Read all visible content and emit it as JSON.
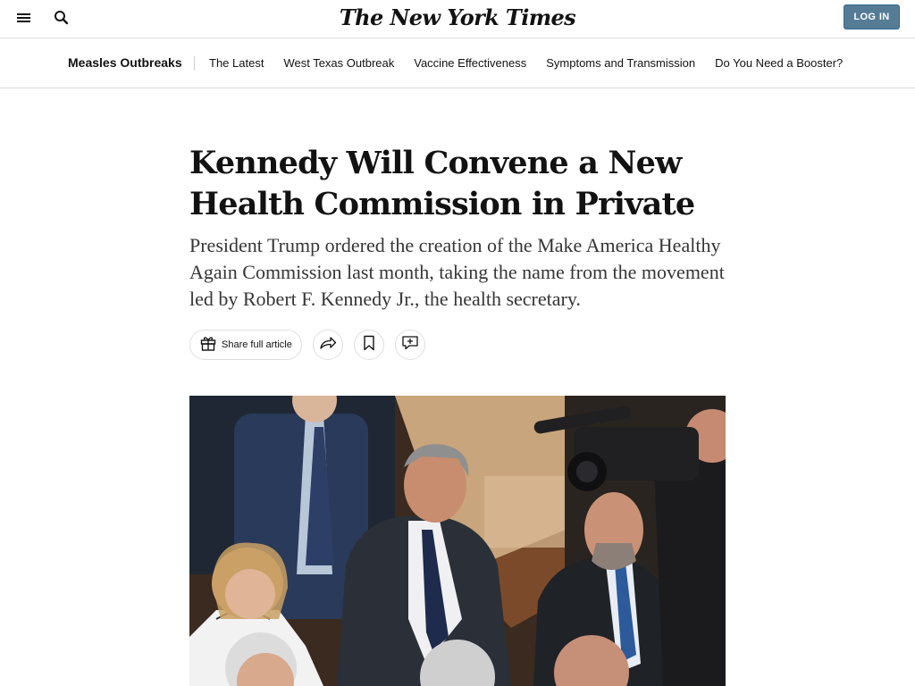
{
  "masthead": {
    "logo_text": "The New York Times",
    "login_label": "LOG IN",
    "menu_icon": "hamburger-menu-icon",
    "search_icon": "search-icon",
    "login_color": "#567b95"
  },
  "subnav": {
    "title": "Measles Outbreaks",
    "links": [
      "The Latest",
      "West Texas Outbreak",
      "Vaccine Effectiveness",
      "Symptoms and Transmission",
      "Do You Need a Booster?"
    ]
  },
  "article": {
    "headline_line1": "Kennedy Will Convene a New",
    "headline_line2": "Health Commission in Private",
    "summary": "President Trump ordered the creation of the Make America Healthy Again Commission last month, taking the name from the movement led by Robert F. Kennedy Jr., the health secretary."
  },
  "toolbar": {
    "share_full_label": "Share full article",
    "gift_icon": "gift-icon",
    "share_icon": "share-arrow-icon",
    "save_icon": "bookmark-icon",
    "comment_icon": "comment-add-icon"
  }
}
